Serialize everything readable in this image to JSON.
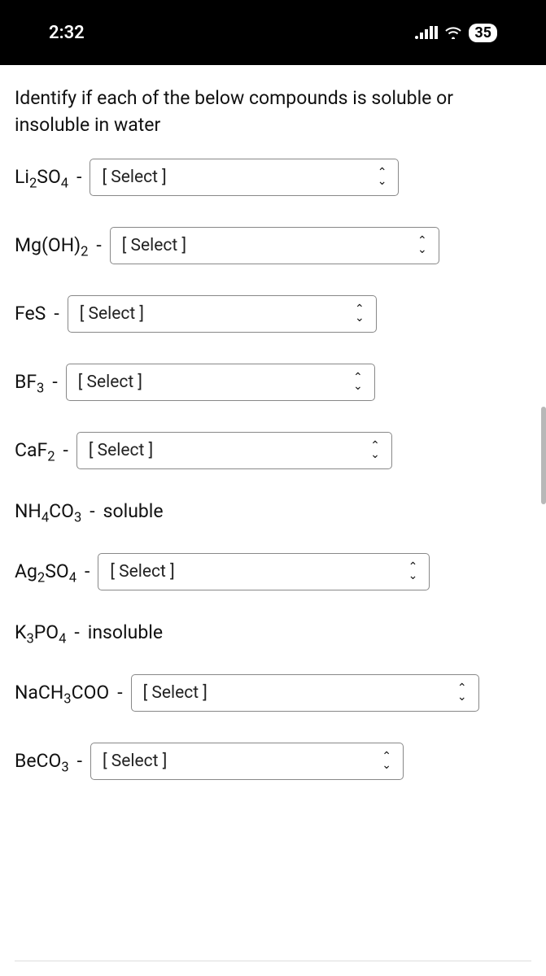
{
  "status_bar": {
    "time": "2:32",
    "battery": "35"
  },
  "instruction": "Identify if each of the below compounds is soluble or insoluble in water",
  "select_placeholder": "[ Select ]",
  "items": [
    {
      "formula_html": "Li<sub>2</sub>SO<sub>4</sub>",
      "type": "select"
    },
    {
      "formula_html": "Mg(OH)<sub>2</sub>",
      "type": "select"
    },
    {
      "formula_html": "FeS",
      "type": "select"
    },
    {
      "formula_html": "BF<sub>3</sub>",
      "type": "select"
    },
    {
      "formula_html": "CaF<sub>2</sub>",
      "type": "select"
    },
    {
      "formula_html": "NH<sub>4</sub>CO<sub>3</sub>",
      "type": "fixed",
      "value": "soluble"
    },
    {
      "formula_html": "Ag<sub>2</sub>SO<sub>4</sub>",
      "type": "select"
    },
    {
      "formula_html": "K<sub>3</sub>PO<sub>4</sub>",
      "type": "fixed",
      "value": "insoluble"
    },
    {
      "formula_html": "NaCH<sub>3</sub>COO",
      "type": "select"
    },
    {
      "formula_html": "BeCO<sub>3</sub>",
      "type": "select"
    }
  ]
}
